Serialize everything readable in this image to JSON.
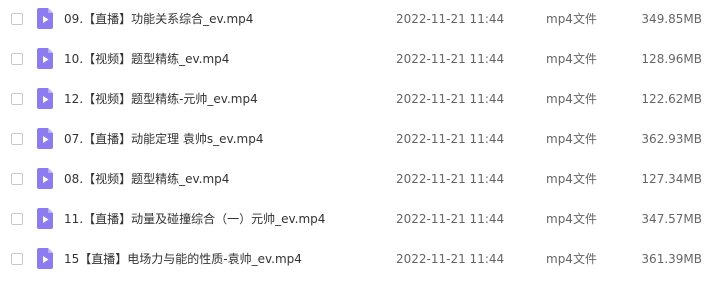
{
  "colors": {
    "icon_fill": "#8c7cf0",
    "icon_fold": "#b9afff",
    "icon_play": "#ffffff"
  },
  "files": [
    {
      "name": "09.【直播】功能关系综合_ev.mp4",
      "date": "2022-11-21 11:44",
      "type": "mp4文件",
      "size": "349.85MB",
      "icon": "video-file-icon"
    },
    {
      "name": "10.【视频】题型精练_ev.mp4",
      "date": "2022-11-21 11:44",
      "type": "mp4文件",
      "size": "128.96MB",
      "icon": "video-file-icon"
    },
    {
      "name": "12.【视频】题型精练-元帅_ev.mp4",
      "date": "2022-11-21 11:44",
      "type": "mp4文件",
      "size": "122.62MB",
      "icon": "video-file-icon"
    },
    {
      "name": "07.【直播】动能定理 袁帅s_ev.mp4",
      "date": "2022-11-21 11:44",
      "type": "mp4文件",
      "size": "362.93MB",
      "icon": "video-file-icon"
    },
    {
      "name": "08.【视频】题型精练_ev.mp4",
      "date": "2022-11-21 11:44",
      "type": "mp4文件",
      "size": "127.34MB",
      "icon": "video-file-icon"
    },
    {
      "name": "11.【直播】动量及碰撞综合（一）元帅_ev.mp4",
      "date": "2022-11-21 11:44",
      "type": "mp4文件",
      "size": "347.57MB",
      "icon": "video-file-icon"
    },
    {
      "name": "15【直播】电场力与能的性质-袁帅_ev.mp4",
      "date": "2022-11-21 11:44",
      "type": "mp4文件",
      "size": "361.39MB",
      "icon": "video-file-icon"
    }
  ]
}
